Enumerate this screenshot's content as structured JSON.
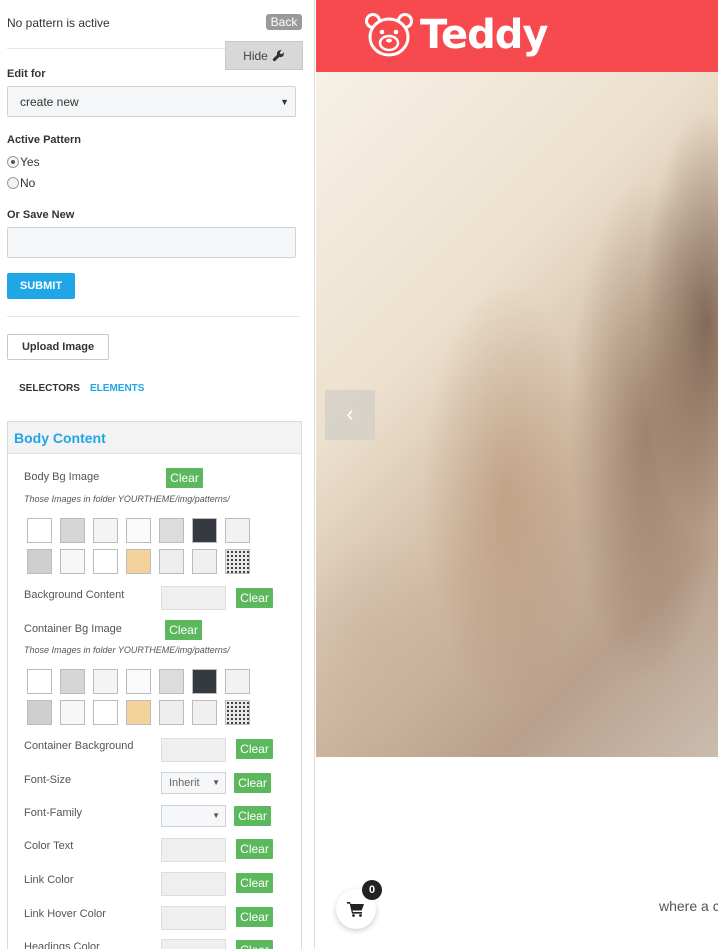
{
  "panel": {
    "status": "No pattern is active",
    "back_label": "Back",
    "hide_label": "Hide",
    "edit_for_label": "Edit for",
    "edit_for_value": "create new",
    "active_pattern_label": "Active Pattern",
    "radio_yes": "Yes",
    "radio_no": "No",
    "active_pattern_selected": "Yes",
    "save_new_label": "Or Save New",
    "save_new_value": "",
    "submit_label": "SUBMIT",
    "upload_label": "Upload Image",
    "tabs": [
      {
        "label": "SELECTORS",
        "active": false
      },
      {
        "label": "ELEMENTS",
        "active": true
      }
    ],
    "section_title": "Body Content",
    "clear_label": "Clear",
    "patterns_note": "Those Images in folder YOURTHEME/img/patterns/",
    "fields": {
      "body_bg_image": "Body Bg Image",
      "background_content": "Background Content",
      "container_bg_image": "Container Bg Image",
      "container_background": "Container Background",
      "font_size": "Font-Size",
      "font_size_value": "Inherit",
      "font_family": "Font-Family",
      "color_text": "Color Text",
      "link_color": "Link Color",
      "link_hover_color": "Link Hover Color",
      "headings_color": "Headings Color"
    },
    "pattern_colors": [
      "#ffffff",
      "#d6d6d6",
      "#f4f4f4",
      "#fafafa",
      "#dcdcdc",
      "#353a42",
      "#f2f2f2",
      "#cfcfcf",
      "#f7f7f7",
      "#ffffff",
      "#f4d29c",
      "#eeeeee",
      "#f0f0f0",
      "#e8e8e8"
    ],
    "accent": "#1fa6e6",
    "clear_color": "#5cb85c"
  },
  "site": {
    "brand": "Teddy",
    "brand_color": "#f74a4f",
    "prev_arrow": "‹",
    "cart_count": "0",
    "tagline": "where a c"
  }
}
